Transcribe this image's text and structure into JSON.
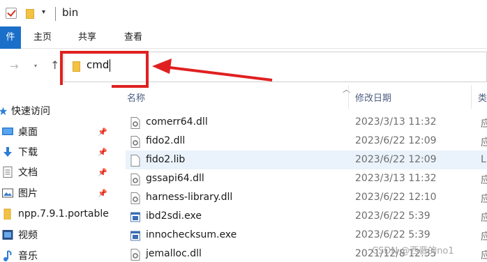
{
  "window": {
    "title": "bin"
  },
  "ribbon": {
    "file_tab": "件",
    "tabs": [
      "主页",
      "共享",
      "查看"
    ]
  },
  "address": {
    "value": "cmd",
    "forward_glyph": "→",
    "up_glyph": "↑"
  },
  "nav": {
    "items": [
      {
        "label": "快速访问",
        "icon": "star-icon",
        "pinned": false
      },
      {
        "label": "桌面",
        "icon": "desktop-icon",
        "pinned": true
      },
      {
        "label": "下载",
        "icon": "download-icon",
        "pinned": true
      },
      {
        "label": "文档",
        "icon": "document-icon",
        "pinned": true
      },
      {
        "label": "图片",
        "icon": "picture-icon",
        "pinned": true
      },
      {
        "label": "npp.7.9.1.portable",
        "icon": "folder-icon",
        "pinned": false
      },
      {
        "label": "视频",
        "icon": "video-icon",
        "pinned": false
      },
      {
        "label": "音乐",
        "icon": "music-icon",
        "pinned": false
      }
    ],
    "pin_glyph": "📌"
  },
  "columns": {
    "name": "名称",
    "date": "修改日期",
    "type": "类"
  },
  "files": [
    {
      "name": "comerr64.dll",
      "date": "2023/3/13 11:32",
      "type": "应",
      "icon": "dll-icon"
    },
    {
      "name": "fido2.dll",
      "date": "2023/6/22 12:09",
      "type": "应",
      "icon": "dll-icon"
    },
    {
      "name": "fido2.lib",
      "date": "2023/6/22 12:09",
      "type": "LI",
      "icon": "file-icon"
    },
    {
      "name": "gssapi64.dll",
      "date": "2023/3/13 11:32",
      "type": "应",
      "icon": "dll-icon"
    },
    {
      "name": "harness-library.dll",
      "date": "2023/6/22 12:10",
      "type": "应",
      "icon": "dll-icon"
    },
    {
      "name": "ibd2sdi.exe",
      "date": "2023/6/22 5:39",
      "type": "应",
      "icon": "exe-icon"
    },
    {
      "name": "innochecksum.exe",
      "date": "2023/6/22 5:39",
      "type": "应",
      "icon": "exe-icon"
    },
    {
      "name": "jemalloc.dll",
      "date": "2021/12/8 12:35",
      "type": "应",
      "icon": "dll-icon"
    }
  ],
  "watermark": "CSDN @西晋的no1",
  "colors": {
    "accent": "#1a6fc9",
    "highlight": "#e02020",
    "selected_row": "#eaf3fb"
  }
}
